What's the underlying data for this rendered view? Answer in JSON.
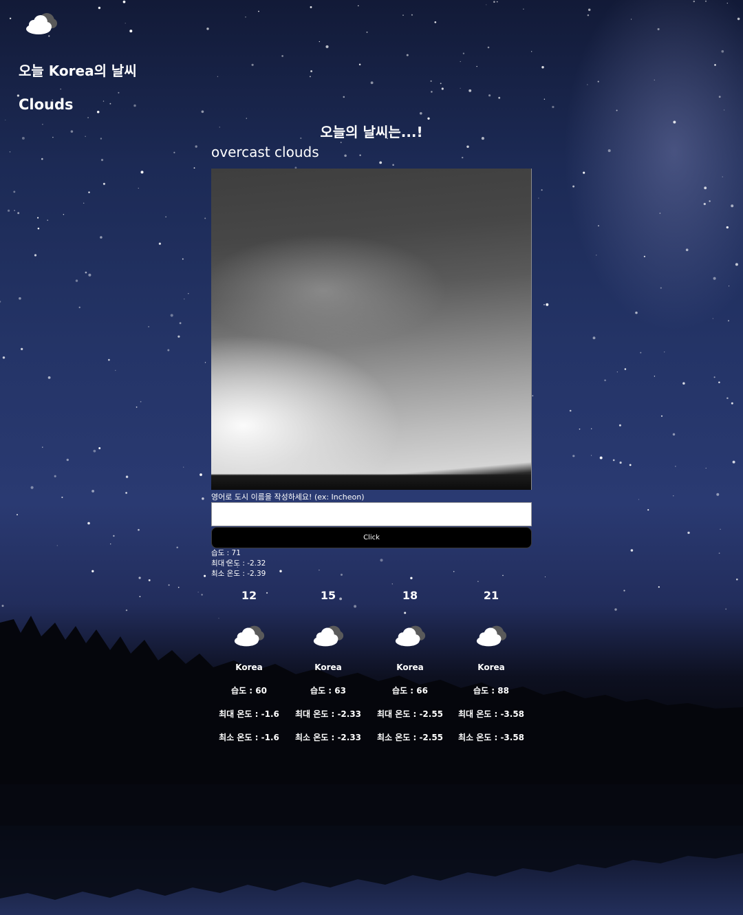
{
  "header": {
    "weather_icon": "cloud-icon",
    "city_title": "오늘 Korea의 날씨",
    "main_condition": "Clouds"
  },
  "today": {
    "heading": "오늘의 날씨는...!",
    "description": "overcast clouds"
  },
  "search": {
    "label": "영어로 도시 이름을 작성하세요! (ex: Incheon)",
    "value": "",
    "placeholder": "",
    "button_label": "Click"
  },
  "current_stats": {
    "humidity": "습도 : 71",
    "max_temp": "최대 온도 : -2.32",
    "min_temp": "최소 온도 : -2.39"
  },
  "forecast": [
    {
      "time": "12",
      "icon": "cloud-icon",
      "city": "Korea",
      "humidity": "습도 : 60",
      "max_temp": "최대 온도 : -1.6",
      "min_temp": "최소 온도 : -1.6"
    },
    {
      "time": "15",
      "icon": "cloud-icon",
      "city": "Korea",
      "humidity": "습도 : 63",
      "max_temp": "최대 온도 : -2.33",
      "min_temp": "최소 온도 : -2.33"
    },
    {
      "time": "18",
      "icon": "cloud-icon",
      "city": "Korea",
      "humidity": "습도 : 66",
      "max_temp": "최대 온도 : -2.55",
      "min_temp": "최소 온도 : -2.55"
    },
    {
      "time": "21",
      "icon": "cloud-icon",
      "city": "Korea",
      "humidity": "습도 : 88",
      "max_temp": "최대 온도 : -3.58",
      "min_temp": "최소 온도 : -3.58"
    }
  ],
  "colors": {
    "text": "#ffffff",
    "button_bg": "#000000",
    "sky_dark": "#121a37",
    "sky_mid": "#2a3a72"
  }
}
